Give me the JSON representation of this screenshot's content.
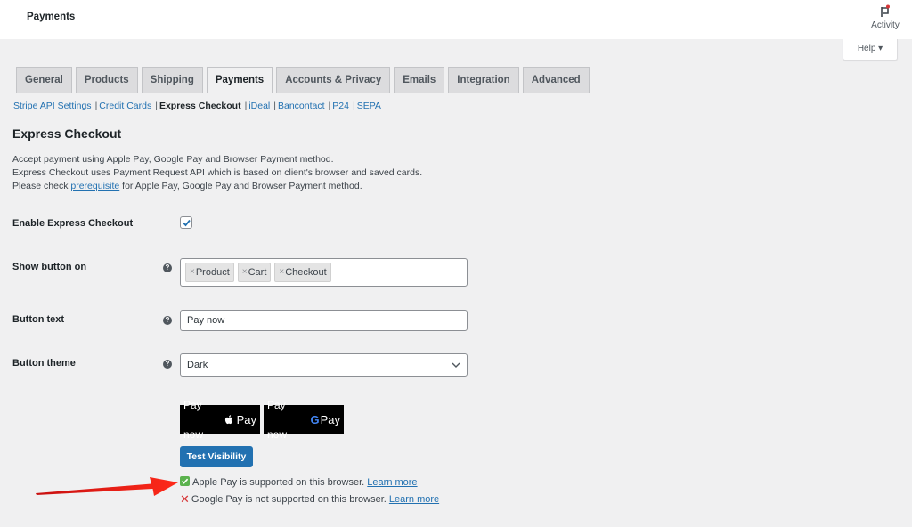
{
  "header": {
    "title": "Payments",
    "activity_label": "Activity",
    "help_label": "Help ▾"
  },
  "tabs": [
    {
      "label": "General",
      "active": false
    },
    {
      "label": "Products",
      "active": false
    },
    {
      "label": "Shipping",
      "active": false
    },
    {
      "label": "Payments",
      "active": true
    },
    {
      "label": "Accounts & Privacy",
      "active": false
    },
    {
      "label": "Emails",
      "active": false
    },
    {
      "label": "Integration",
      "active": false
    },
    {
      "label": "Advanced",
      "active": false
    }
  ],
  "subnav": [
    {
      "label": "Stripe API Settings",
      "current": false
    },
    {
      "label": "Credit Cards",
      "current": false
    },
    {
      "label": "Express Checkout",
      "current": true
    },
    {
      "label": "iDeal",
      "current": false
    },
    {
      "label": "Bancontact",
      "current": false
    },
    {
      "label": "P24",
      "current": false
    },
    {
      "label": "SEPA",
      "current": false
    }
  ],
  "section": {
    "title": "Express Checkout",
    "desc_line1": "Accept payment using Apple Pay, Google Pay and Browser Payment method.",
    "desc_line2": "Express Checkout uses Payment Request API which is based on client's browser and saved cards.",
    "desc_line3_pre": "Please check ",
    "desc_line3_link": "prerequisite",
    "desc_line3_post": " for Apple Pay, Google Pay and Browser Payment method."
  },
  "form": {
    "enable_label": "Enable Express Checkout",
    "enable_checked": true,
    "show_on_label": "Show button on",
    "show_on_values": [
      "Product",
      "Cart",
      "Checkout"
    ],
    "chip_remove_glyph": "×",
    "button_text_label": "Button text",
    "button_text_value": "Pay now",
    "button_theme_label": "Button theme",
    "button_theme_value": "Dark",
    "help_glyph": "?"
  },
  "preview": {
    "apple_text": "Pay now",
    "apple_brand": "Pay",
    "google_text": "Pay now",
    "google_g": "G",
    "google_brand": "Pay",
    "test_button": "Test Visibility"
  },
  "status": {
    "apple_text": "Apple Pay is supported on this browser.",
    "apple_link": "Learn more",
    "google_text": "Google Pay is not supported on this browser.",
    "google_link": "Learn more",
    "no_glyph": "✕"
  },
  "colors": {
    "accent": "#2271b1",
    "ok": "#5bb24e",
    "error": "#d63638",
    "arrow": "#e02020"
  }
}
